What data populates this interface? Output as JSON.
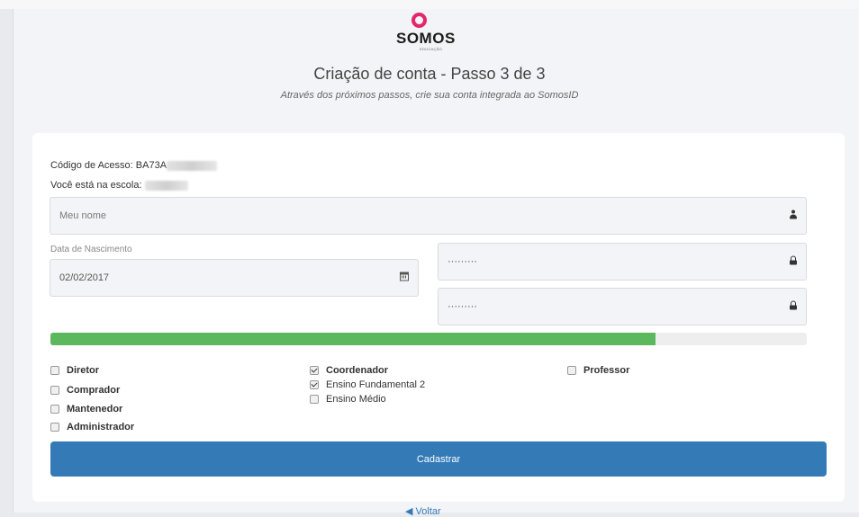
{
  "brand": {
    "name": "SOMOS",
    "sub": "EDUCAÇÃO"
  },
  "header": {
    "title": "Criação de conta - Passo 3 de 3",
    "subtitle": "Através dos próximos passos, crie sua conta integrada ao SomosID"
  },
  "info": {
    "access_code_label": "Código de Acesso: BA73A",
    "school_label": "Você está na escola:"
  },
  "form": {
    "name_placeholder": "Meu nome",
    "dob_label": "Data de Nascimento",
    "dob_value": "02/02/2017",
    "password_value": "·········",
    "password_confirm_value": "·········",
    "progress_percent": 80
  },
  "roles": {
    "col1": [
      {
        "label": "Diretor",
        "checked": false
      },
      {
        "label": "Comprador",
        "checked": false
      },
      {
        "label": "Mantenedor",
        "checked": false
      },
      {
        "label": "Administrador",
        "checked": false
      }
    ],
    "col2": [
      {
        "label": "Coordenador",
        "checked": true
      },
      {
        "label": "Ensino Fundamental 2",
        "checked": true
      },
      {
        "label": "Ensino Médio",
        "checked": false
      }
    ],
    "col3": [
      {
        "label": "Professor",
        "checked": false
      }
    ]
  },
  "actions": {
    "submit_label": "Cadastrar",
    "back_label": "Voltar"
  },
  "icons": {
    "name": "user-icon",
    "date": "calendar-icon",
    "password": "lock-icon"
  },
  "colors": {
    "accent": "#337ab7",
    "progress": "#5cb85c",
    "brand": "#e4266a"
  }
}
